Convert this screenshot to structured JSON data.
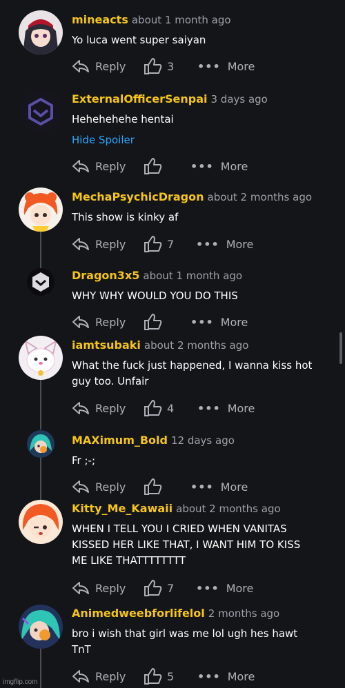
{
  "actions": {
    "reply": "Reply",
    "more": "More"
  },
  "comments": [
    {
      "username": "mineacts",
      "time": "about 1 month ago",
      "lines": [
        "Yo luca went super saiyan"
      ],
      "likes": "3"
    },
    {
      "username": "ExternalOfficerSenpai",
      "time": "3 days ago",
      "lines": [
        "Hehehehehe hentai"
      ],
      "spoiler": "Hide Spoiler",
      "likes": ""
    },
    {
      "username": "MechaPsychicDragon",
      "time": "about 2 months ago",
      "lines": [
        "This show is kinky af"
      ],
      "likes": "7"
    },
    {
      "username": "Dragon3x5",
      "time": "about 1 month ago",
      "lines": [
        "WHY WHY WOULD YOU DO THIS"
      ],
      "likes": ""
    },
    {
      "username": "iamtsubaki",
      "time": "about 2 months ago",
      "lines": [
        "What the fuck just happened, I wanna kiss hot",
        "guy too. Unfair"
      ],
      "likes": "4"
    },
    {
      "username": "MAXimum_Bold",
      "time": "12 days ago",
      "lines": [
        "Fr ;-;"
      ],
      "likes": ""
    },
    {
      "username": "Kitty_Me_Kawaii",
      "time": "about 2 months ago",
      "lines": [
        "WHEN I TELL YOU I CRIED WHEN VANITAS",
        "KISSED HER LIKE THAT, I WANT HIM TO KISS",
        "ME LIKE THATTTTTTTT"
      ],
      "likes": "7"
    },
    {
      "username": "Animedweebforlifelol",
      "time": "2 months ago",
      "lines": [
        "bro i wish that girl was me lol ugh hes hawt",
        "TnT"
      ],
      "likes": "5"
    }
  ],
  "watermark": "imgflip.com"
}
